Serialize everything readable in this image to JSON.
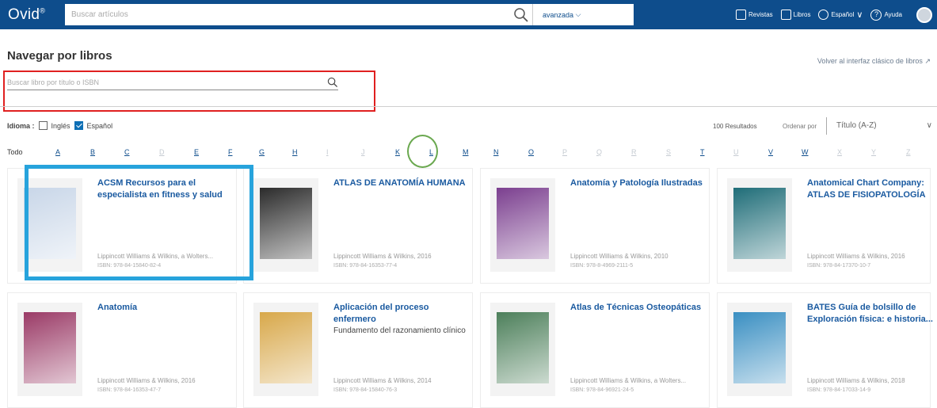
{
  "header": {
    "logo": "Ovid",
    "logo_mark": "®",
    "search_placeholder": "Buscar artículos",
    "advanced": "avanzada",
    "nav": {
      "journals": "Revistas",
      "books": "Libros",
      "language": "Español",
      "help": "Ayuda"
    }
  },
  "page": {
    "title": "Navegar por libros",
    "classic_link": "Volver al interfaz clásico de libros",
    "book_search_placeholder": "Buscar libro por título o ISBN"
  },
  "filters": {
    "language_label": "Idioma :",
    "english": "Inglés",
    "spanish": "Español",
    "english_checked": false,
    "spanish_checked": true
  },
  "results": {
    "count": "100 Resultados",
    "sort_label": "Ordenar por",
    "sort_value": "Título (A-Z)"
  },
  "letters": {
    "all": "Todo",
    "items": [
      "A",
      "B",
      "C",
      "D",
      "E",
      "F",
      "G",
      "H",
      "I",
      "J",
      "K",
      "L",
      "M",
      "N",
      "O",
      "P",
      "Q",
      "R",
      "S",
      "T",
      "U",
      "V",
      "W",
      "X",
      "Y",
      "Z"
    ],
    "enabled": [
      "A",
      "B",
      "C",
      "E",
      "F",
      "G",
      "H",
      "K",
      "L",
      "M",
      "N",
      "O",
      "T",
      "V",
      "W"
    ]
  },
  "books": [
    {
      "title": "ACSM Recursos para el especialista en fitness y salud",
      "subtitle": "",
      "publisher": "Lippincott Williams & Wilkins, a Wolters...",
      "isbn": "ISBN: 978-84-15840-82-4",
      "cover_color": "#c8d6e8"
    },
    {
      "title": "ATLAS DE ANATOMÍA HUMANA",
      "subtitle": "",
      "publisher": "Lippincott Williams & Wilkins, 2016",
      "isbn": "ISBN: 978-84-16353-77-4",
      "cover_color": "#2b2b2b"
    },
    {
      "title": "Anatomía y Patología Ilustradas",
      "subtitle": "",
      "publisher": "Lippincott Williams & Wilkins, 2010",
      "isbn": "ISBN: 978-8-4969-2111-5",
      "cover_color": "#7b3f8f"
    },
    {
      "title": "Anatomical Chart Company: ATLAS DE FISIOPATOLOGÍA",
      "subtitle": "",
      "publisher": "Lippincott Williams & Wilkins, 2016",
      "isbn": "ISBN: 978-84-17370-10-7",
      "cover_color": "#1f6d78"
    },
    {
      "title": "Anatomía",
      "subtitle": "",
      "publisher": "Lippincott Williams & Wilkins, 2016",
      "isbn": "ISBN: 978-84-16353-47-7",
      "cover_color": "#9a3a66"
    },
    {
      "title": "Aplicación del proceso enfermero",
      "subtitle": "Fundamento del razonamiento clínico",
      "publisher": "Lippincott Williams & Wilkins, 2014",
      "isbn": "ISBN: 978-84-15840-76-3",
      "cover_color": "#d8a84a"
    },
    {
      "title": "Atlas de Técnicas Osteopáticas",
      "subtitle": "",
      "publisher": "Lippincott Williams & Wilkins, a Wolters...",
      "isbn": "ISBN: 978-84-96921-24-5",
      "cover_color": "#4c7f5a"
    },
    {
      "title": "BATES Guía de bolsillo de Exploración física: e historia...",
      "subtitle": "",
      "publisher": "Lippincott Williams & Wilkins, 2018",
      "isbn": "ISBN: 978-84-17033-14-9",
      "cover_color": "#3a8fc2"
    }
  ]
}
